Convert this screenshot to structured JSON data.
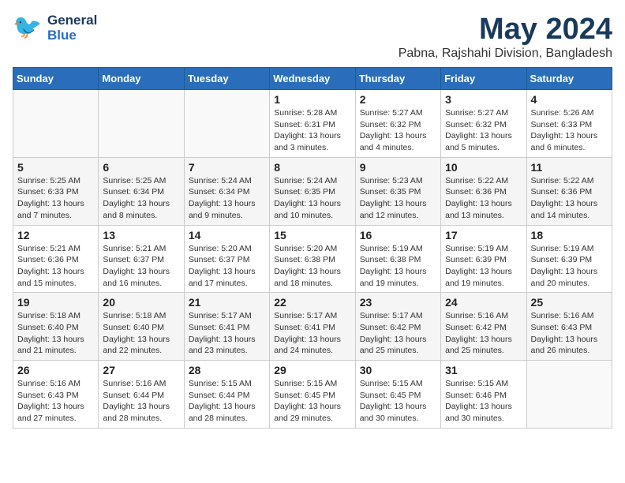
{
  "logo": {
    "general": "General",
    "blue": "Blue"
  },
  "title": "May 2024",
  "subtitle": "Pabna, Rajshahi Division, Bangladesh",
  "days_of_week": [
    "Sunday",
    "Monday",
    "Tuesday",
    "Wednesday",
    "Thursday",
    "Friday",
    "Saturday"
  ],
  "weeks": [
    {
      "days": [
        {
          "num": "",
          "info": ""
        },
        {
          "num": "",
          "info": ""
        },
        {
          "num": "",
          "info": ""
        },
        {
          "num": "1",
          "info": "Sunrise: 5:28 AM\nSunset: 6:31 PM\nDaylight: 13 hours and 3 minutes."
        },
        {
          "num": "2",
          "info": "Sunrise: 5:27 AM\nSunset: 6:32 PM\nDaylight: 13 hours and 4 minutes."
        },
        {
          "num": "3",
          "info": "Sunrise: 5:27 AM\nSunset: 6:32 PM\nDaylight: 13 hours and 5 minutes."
        },
        {
          "num": "4",
          "info": "Sunrise: 5:26 AM\nSunset: 6:33 PM\nDaylight: 13 hours and 6 minutes."
        }
      ]
    },
    {
      "days": [
        {
          "num": "5",
          "info": "Sunrise: 5:25 AM\nSunset: 6:33 PM\nDaylight: 13 hours and 7 minutes."
        },
        {
          "num": "6",
          "info": "Sunrise: 5:25 AM\nSunset: 6:34 PM\nDaylight: 13 hours and 8 minutes."
        },
        {
          "num": "7",
          "info": "Sunrise: 5:24 AM\nSunset: 6:34 PM\nDaylight: 13 hours and 9 minutes."
        },
        {
          "num": "8",
          "info": "Sunrise: 5:24 AM\nSunset: 6:35 PM\nDaylight: 13 hours and 10 minutes."
        },
        {
          "num": "9",
          "info": "Sunrise: 5:23 AM\nSunset: 6:35 PM\nDaylight: 13 hours and 12 minutes."
        },
        {
          "num": "10",
          "info": "Sunrise: 5:22 AM\nSunset: 6:36 PM\nDaylight: 13 hours and 13 minutes."
        },
        {
          "num": "11",
          "info": "Sunrise: 5:22 AM\nSunset: 6:36 PM\nDaylight: 13 hours and 14 minutes."
        }
      ]
    },
    {
      "days": [
        {
          "num": "12",
          "info": "Sunrise: 5:21 AM\nSunset: 6:36 PM\nDaylight: 13 hours and 15 minutes."
        },
        {
          "num": "13",
          "info": "Sunrise: 5:21 AM\nSunset: 6:37 PM\nDaylight: 13 hours and 16 minutes."
        },
        {
          "num": "14",
          "info": "Sunrise: 5:20 AM\nSunset: 6:37 PM\nDaylight: 13 hours and 17 minutes."
        },
        {
          "num": "15",
          "info": "Sunrise: 5:20 AM\nSunset: 6:38 PM\nDaylight: 13 hours and 18 minutes."
        },
        {
          "num": "16",
          "info": "Sunrise: 5:19 AM\nSunset: 6:38 PM\nDaylight: 13 hours and 19 minutes."
        },
        {
          "num": "17",
          "info": "Sunrise: 5:19 AM\nSunset: 6:39 PM\nDaylight: 13 hours and 19 minutes."
        },
        {
          "num": "18",
          "info": "Sunrise: 5:19 AM\nSunset: 6:39 PM\nDaylight: 13 hours and 20 minutes."
        }
      ]
    },
    {
      "days": [
        {
          "num": "19",
          "info": "Sunrise: 5:18 AM\nSunset: 6:40 PM\nDaylight: 13 hours and 21 minutes."
        },
        {
          "num": "20",
          "info": "Sunrise: 5:18 AM\nSunset: 6:40 PM\nDaylight: 13 hours and 22 minutes."
        },
        {
          "num": "21",
          "info": "Sunrise: 5:17 AM\nSunset: 6:41 PM\nDaylight: 13 hours and 23 minutes."
        },
        {
          "num": "22",
          "info": "Sunrise: 5:17 AM\nSunset: 6:41 PM\nDaylight: 13 hours and 24 minutes."
        },
        {
          "num": "23",
          "info": "Sunrise: 5:17 AM\nSunset: 6:42 PM\nDaylight: 13 hours and 25 minutes."
        },
        {
          "num": "24",
          "info": "Sunrise: 5:16 AM\nSunset: 6:42 PM\nDaylight: 13 hours and 25 minutes."
        },
        {
          "num": "25",
          "info": "Sunrise: 5:16 AM\nSunset: 6:43 PM\nDaylight: 13 hours and 26 minutes."
        }
      ]
    },
    {
      "days": [
        {
          "num": "26",
          "info": "Sunrise: 5:16 AM\nSunset: 6:43 PM\nDaylight: 13 hours and 27 minutes."
        },
        {
          "num": "27",
          "info": "Sunrise: 5:16 AM\nSunset: 6:44 PM\nDaylight: 13 hours and 28 minutes."
        },
        {
          "num": "28",
          "info": "Sunrise: 5:15 AM\nSunset: 6:44 PM\nDaylight: 13 hours and 28 minutes."
        },
        {
          "num": "29",
          "info": "Sunrise: 5:15 AM\nSunset: 6:45 PM\nDaylight: 13 hours and 29 minutes."
        },
        {
          "num": "30",
          "info": "Sunrise: 5:15 AM\nSunset: 6:45 PM\nDaylight: 13 hours and 30 minutes."
        },
        {
          "num": "31",
          "info": "Sunrise: 5:15 AM\nSunset: 6:46 PM\nDaylight: 13 hours and 30 minutes."
        },
        {
          "num": "",
          "info": ""
        }
      ]
    }
  ]
}
